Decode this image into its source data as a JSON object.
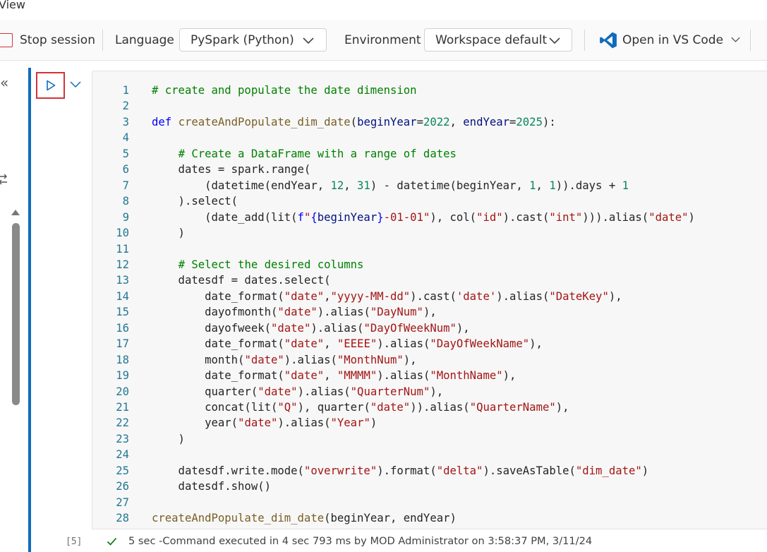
{
  "menu": {
    "view_label": "View"
  },
  "toolbar": {
    "stop_label": "Stop session",
    "language_label": "Language",
    "language_value": "PySpark (Python)",
    "environment_label": "Environment",
    "environment_value": "Workspace default",
    "vscode_label": "Open in VS Code",
    "accent_color": "#0f6cbd",
    "stop_color": "#d13438"
  },
  "rail": {
    "collapse_glyph": "«"
  },
  "cell": {
    "execution_count": "[5]",
    "status_text": "5 sec -Command executed in 4 sec 793 ms by MOD Administrator on 3:58:37 PM, 3/11/24",
    "code_lines": [
      {
        "n": "1",
        "text": "# create and populate the date dimension"
      },
      {
        "n": "2",
        "text": ""
      },
      {
        "n": "3",
        "text": "def createAndPopulate_dim_date(beginYear=2022, endYear=2025):"
      },
      {
        "n": "4",
        "text": ""
      },
      {
        "n": "5",
        "text": "    # Create a DataFrame with a range of dates"
      },
      {
        "n": "6",
        "text": "    dates = spark.range("
      },
      {
        "n": "7",
        "text": "        (datetime(endYear, 12, 31) - datetime(beginYear, 1, 1)).days + 1"
      },
      {
        "n": "8",
        "text": "    ).select("
      },
      {
        "n": "9",
        "text": "        (date_add(lit(f\"{beginYear}-01-01\"), col(\"id\").cast(\"int\"))).alias(\"date\")"
      },
      {
        "n": "10",
        "text": "    )"
      },
      {
        "n": "11",
        "text": ""
      },
      {
        "n": "12",
        "text": "    # Select the desired columns"
      },
      {
        "n": "13",
        "text": "    datesdf = dates.select("
      },
      {
        "n": "14",
        "text": "        date_format(\"date\",\"yyyy-MM-dd\").cast('date').alias(\"DateKey\"),"
      },
      {
        "n": "15",
        "text": "        dayofmonth(\"date\").alias(\"DayNum\"),"
      },
      {
        "n": "16",
        "text": "        dayofweek(\"date\").alias(\"DayOfWeekNum\"),"
      },
      {
        "n": "17",
        "text": "        date_format(\"date\", \"EEEE\").alias(\"DayOfWeekName\"),"
      },
      {
        "n": "18",
        "text": "        month(\"date\").alias(\"MonthNum\"),"
      },
      {
        "n": "19",
        "text": "        date_format(\"date\", \"MMMM\").alias(\"MonthName\"),"
      },
      {
        "n": "20",
        "text": "        quarter(\"date\").alias(\"QuarterNum\"),"
      },
      {
        "n": "21",
        "text": "        concat(lit(\"Q\"), quarter(\"date\")).alias(\"QuarterName\"),"
      },
      {
        "n": "22",
        "text": "        year(\"date\").alias(\"Year\")"
      },
      {
        "n": "23",
        "text": "    )"
      },
      {
        "n": "24",
        "text": ""
      },
      {
        "n": "25",
        "text": "    datesdf.write.mode(\"overwrite\").format(\"delta\").saveAsTable(\"dim_date\")"
      },
      {
        "n": "26",
        "text": "    datesdf.show()"
      },
      {
        "n": "27",
        "text": ""
      },
      {
        "n": "28",
        "text": "createAndPopulate_dim_date(beginYear, endYear)"
      }
    ]
  }
}
